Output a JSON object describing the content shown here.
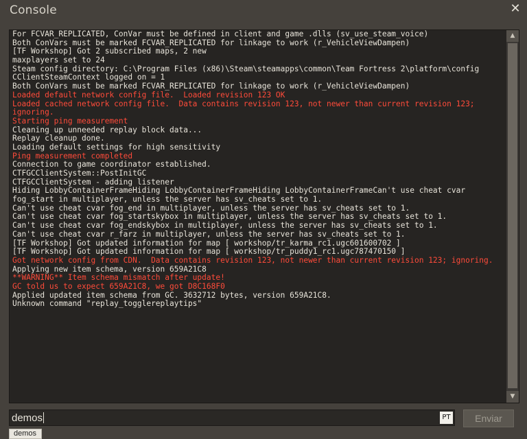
{
  "window": {
    "title": "Console",
    "close_icon": "close-icon",
    "close_glyph": "✕"
  },
  "log": {
    "lines": [
      {
        "text": "For FCVAR_REPLICATED, ConVar must be defined in client and game .dlls (sv_use_steam_voice)",
        "color": "normal"
      },
      {
        "text": "Both ConVars must be marked FCVAR_REPLICATED for linkage to work (r_VehicleViewDampen)",
        "color": "normal"
      },
      {
        "text": "[TF Workshop] Got 2 subscribed maps, 2 new",
        "color": "normal"
      },
      {
        "text": "maxplayers set to 24",
        "color": "normal"
      },
      {
        "text": "Steam config directory: C:\\Program Files (x86)\\Steam\\steamapps\\common\\Team Fortress 2\\platform\\config",
        "color": "normal"
      },
      {
        "text": "CClientSteamContext logged on = 1",
        "color": "normal"
      },
      {
        "text": "Both ConVars must be marked FCVAR_REPLICATED for linkage to work (r_VehicleViewDampen)",
        "color": "normal"
      },
      {
        "text": "Loaded default network config file.  Loaded revision 123 OK",
        "color": "red"
      },
      {
        "text": "Loaded cached network config file.  Data contains revision 123, not newer than current revision 123;",
        "color": "red"
      },
      {
        "text": "ignoring.",
        "color": "red"
      },
      {
        "text": "Starting ping measurement",
        "color": "red"
      },
      {
        "text": "Cleaning up unneeded replay block data...",
        "color": "normal"
      },
      {
        "text": "Replay cleanup done.",
        "color": "normal"
      },
      {
        "text": "Loading default settings for high sensitivity",
        "color": "normal"
      },
      {
        "text": "Ping measurement completed",
        "color": "red"
      },
      {
        "text": "Connection to game coordinator established.",
        "color": "normal"
      },
      {
        "text": "CTFGCClientSystem::PostInitGC",
        "color": "normal"
      },
      {
        "text": "CTFGCClientSystem - adding listener",
        "color": "normal"
      },
      {
        "text": "Hiding LobbyContainerFrameHiding LobbyContainerFrameHiding LobbyContainerFrameCan't use cheat cvar",
        "color": "normal"
      },
      {
        "text": "fog_start in multiplayer, unless the server has sv_cheats set to 1.",
        "color": "normal"
      },
      {
        "text": "Can't use cheat cvar fog_end in multiplayer, unless the server has sv_cheats set to 1.",
        "color": "normal"
      },
      {
        "text": "Can't use cheat cvar fog_startskybox in multiplayer, unless the server has sv_cheats set to 1.",
        "color": "normal"
      },
      {
        "text": "Can't use cheat cvar fog_endskybox in multiplayer, unless the server has sv_cheats set to 1.",
        "color": "normal"
      },
      {
        "text": "Can't use cheat cvar r_farz in multiplayer, unless the server has sv_cheats set to 1.",
        "color": "normal"
      },
      {
        "text": "[TF Workshop] Got updated information for map [ workshop/tr_karma_rc1.ugc601600702 ]",
        "color": "normal"
      },
      {
        "text": "[TF Workshop] Got updated information for map [ workshop/tr_puddy1_rc1.ugc787470150 ]",
        "color": "normal"
      },
      {
        "text": "Got network config from CDN.  Data contains revision 123, not newer than current revision 123; ignoring.",
        "color": "red"
      },
      {
        "text": "Applying new item schema, version 659A21C8",
        "color": "normal"
      },
      {
        "text": "**WARNING** Item schema mismatch after update!",
        "color": "red"
      },
      {
        "text": "GC told us to expect 659A21C8, we got D8C168F0",
        "color": "red"
      },
      {
        "text": "Applied updated item schema from GC. 3632712 bytes, version 659A21C8.",
        "color": "normal"
      },
      {
        "text": "Unknown command \"replay_togglereplaytips\"",
        "color": "normal"
      }
    ]
  },
  "scrollbar": {
    "up_icon": "chevron-up-icon",
    "down_icon": "chevron-down-icon",
    "up_glyph": "▲",
    "down_glyph": "▼"
  },
  "input": {
    "value": "demos",
    "lang_badge": "PT"
  },
  "send_button": {
    "label": "Enviar"
  },
  "suggestions": [
    "demos"
  ],
  "colors": {
    "log_text": "#e8e4da",
    "log_error": "#ff4b3a",
    "panel_bg": "#262422",
    "window_bg": "#45413c"
  }
}
